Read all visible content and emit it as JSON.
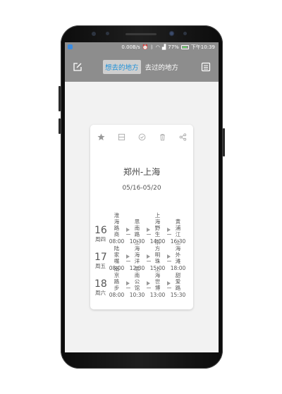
{
  "status_bar": {
    "net_speed": "0.00B/s",
    "battery_pct": "77%",
    "time": "下午10:39",
    "battery_level": 0.77
  },
  "toolbar": {
    "edit_icon": "edit-icon",
    "tabs": [
      {
        "label": "想去的地方",
        "active": true
      },
      {
        "label": "去过的地方",
        "active": false
      }
    ],
    "list_icon": "list-icon"
  },
  "card": {
    "action_icons": [
      "star-icon",
      "save-icon",
      "check-circle-icon",
      "trash-icon",
      "share-icon"
    ],
    "title": "郑州-上海",
    "date_range": "05/16-05/20",
    "days": [
      {
        "day": "16",
        "weekday": "周四",
        "stops": [
          {
            "name": "淮海路商",
            "time": "08:00"
          },
          {
            "name": "思南路",
            "time": "10:30"
          },
          {
            "name": "上海野生",
            "time": "14:00"
          },
          {
            "name": "黄浦江",
            "time": "16:30"
          }
        ]
      },
      {
        "day": "17",
        "weekday": "周五",
        "stops": [
          {
            "name": "陆家嘴",
            "time": "08:00"
          },
          {
            "name": "上海海洋",
            "time": "12:30"
          },
          {
            "name": "东方明珠",
            "time": "15:00"
          },
          {
            "name": "上海外滩",
            "time": "18:00"
          }
        ]
      },
      {
        "day": "18",
        "weekday": "周六",
        "stops": [
          {
            "name": "南京路步",
            "time": "08:00"
          },
          {
            "name": "思南公馆",
            "time": "10:30"
          },
          {
            "name": "上海世博",
            "time": "13:00"
          },
          {
            "name": "甜爱路",
            "time": "15:30"
          }
        ]
      }
    ]
  },
  "colors": {
    "toolbar_bg": "#8d8d8d",
    "active_tab_text": "#1e90d8",
    "screen_bg": "#f2f2f2"
  }
}
